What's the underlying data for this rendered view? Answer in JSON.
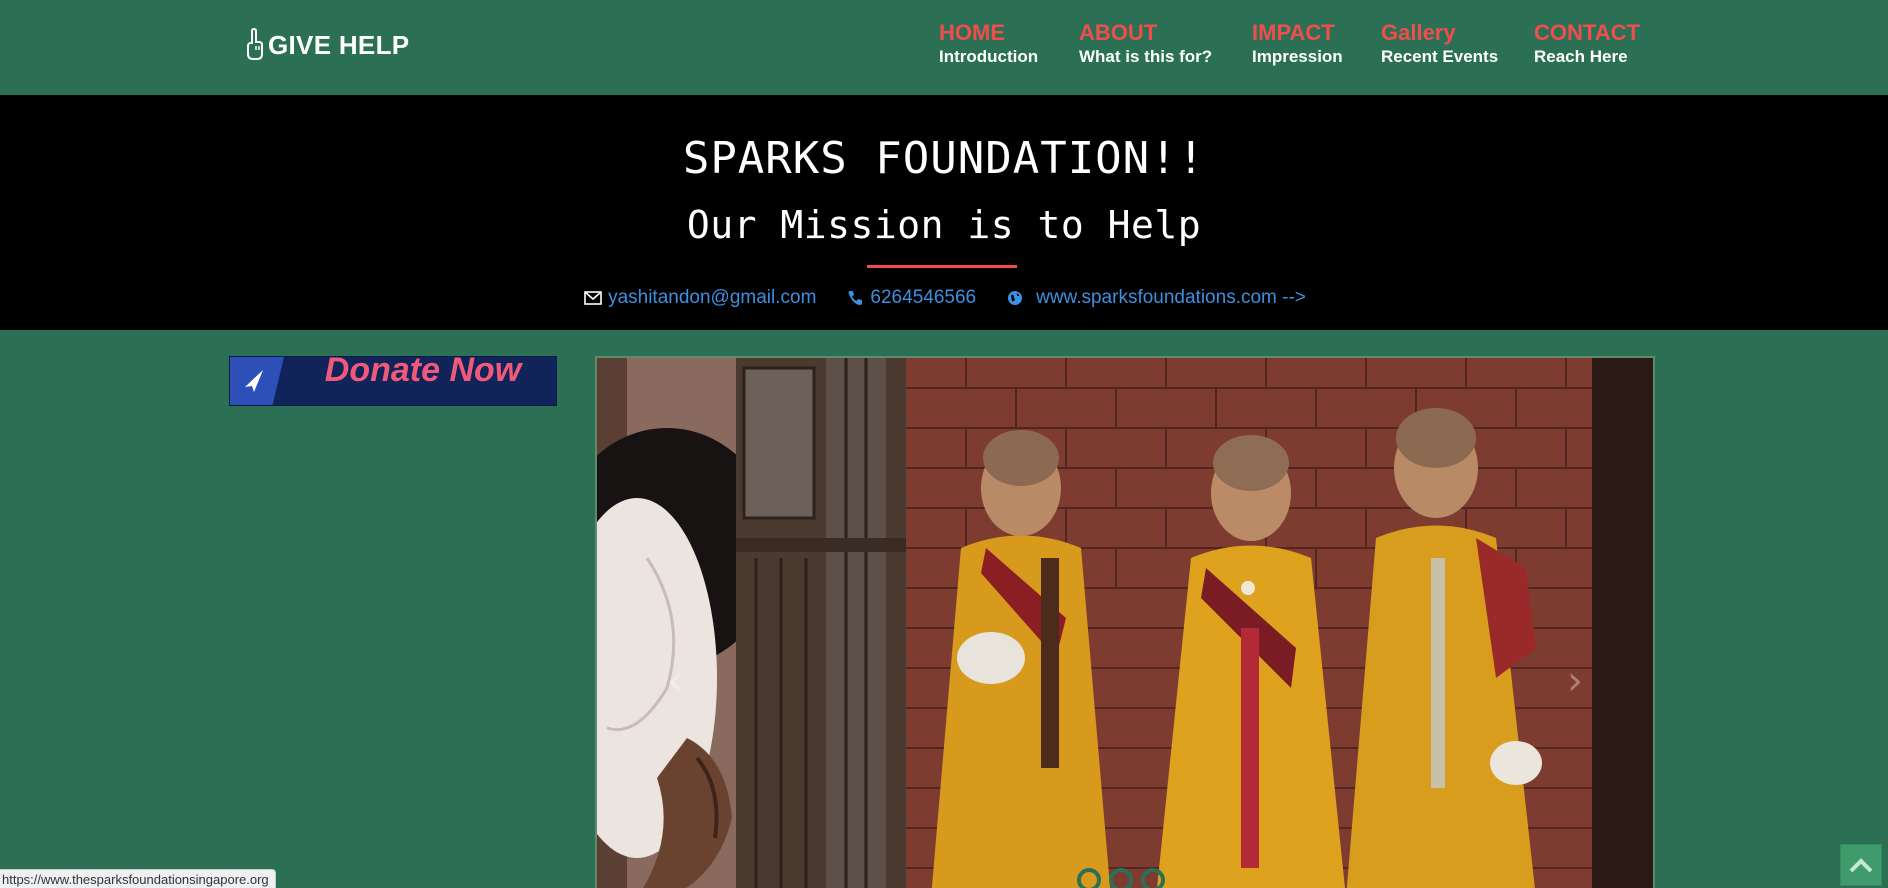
{
  "brand": {
    "icon": "hand-pointing-up-icon",
    "name": "GIVE HELP"
  },
  "nav": [
    {
      "label": "HOME",
      "sub": "Introduction"
    },
    {
      "label": "ABOUT",
      "sub": "What is this for?"
    },
    {
      "label": "IMPACT",
      "sub": "Impression"
    },
    {
      "label": "Gallery",
      "sub": "Recent Events"
    },
    {
      "label": "CONTACT",
      "sub": "Reach Here"
    }
  ],
  "hero": {
    "title": "SPARKS FOUNDATION!!",
    "subtitle": "Our Mission is to Help",
    "email": "yashitandon@gmail.com",
    "phone": "6264546566",
    "website": "www.sparksfoundations.com -->"
  },
  "donate": {
    "label": "Donate Now",
    "icon": "paper-plane-icon"
  },
  "carousel": {
    "prev_icon": "chevron-left-icon",
    "next_icon": "chevron-right-icon",
    "slide_count": 3,
    "active_slide": 1
  },
  "status_bar": {
    "url": "https://www.thesparksfoundationsingapore.org"
  },
  "scroll_top": {
    "icon": "chevron-up-icon"
  },
  "colors": {
    "background": "#2b7055",
    "accent": "#f04d4d",
    "hero_background": "#000000",
    "link": "#3d8fe0",
    "donate_background": "#10245a",
    "donate_text": "#f05a78"
  }
}
